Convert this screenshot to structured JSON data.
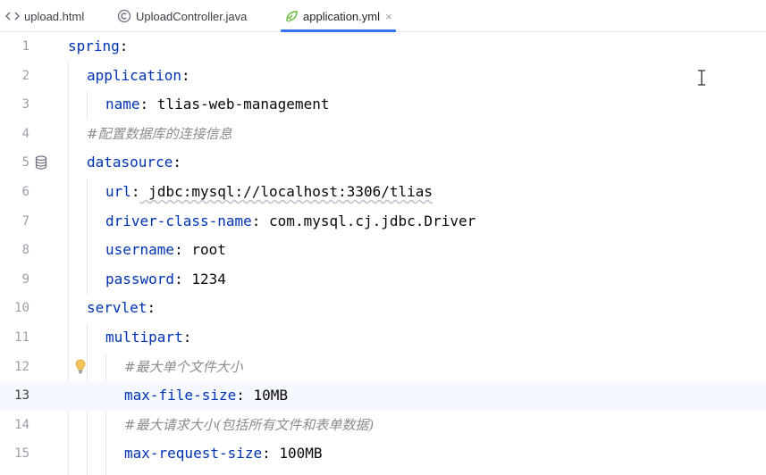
{
  "tabs": [
    {
      "name": "upload.html",
      "icon": "html-file-icon",
      "active": false
    },
    {
      "name": "UploadController.java",
      "icon": "java-class-icon",
      "active": false
    },
    {
      "name": "application.yml",
      "icon": "spring-config-icon",
      "active": true,
      "close": "×"
    }
  ],
  "editor": {
    "current_line": 13,
    "lines": [
      {
        "num": "1",
        "key": "spring",
        "colon": ":",
        "value": ""
      },
      {
        "num": "2",
        "key": "application",
        "colon": ":",
        "value": ""
      },
      {
        "num": "3",
        "key": "name",
        "colon": ":",
        "value": " tlias-web-management"
      },
      {
        "num": "4",
        "comment": "#配置数据库的连接信息"
      },
      {
        "num": "5",
        "key": "datasource",
        "colon": ":",
        "value": ""
      },
      {
        "num": "6",
        "key": "url",
        "colon": ":",
        "value": " jdbc:mysql://localhost:3306/tlias"
      },
      {
        "num": "7",
        "key": "driver-class-name",
        "colon": ":",
        "value": " com.mysql.cj.jdbc.Driver"
      },
      {
        "num": "8",
        "key": "username",
        "colon": ":",
        "value": " root"
      },
      {
        "num": "9",
        "key": "password",
        "colon": ":",
        "value": " 1234"
      },
      {
        "num": "10",
        "key": "servlet",
        "colon": ":",
        "value": ""
      },
      {
        "num": "11",
        "key": "multipart",
        "colon": ":",
        "value": ""
      },
      {
        "num": "12",
        "comment": "#最大单个文件大小"
      },
      {
        "num": "13",
        "key": "max-file-size",
        "colon": ":",
        "value": " 10MB"
      },
      {
        "num": "14",
        "comment": "#最大请求大小(包括所有文件和表单数据)"
      },
      {
        "num": "15",
        "key": "max-request-size",
        "colon": ":",
        "value": " 100MB"
      }
    ]
  },
  "colors": {
    "key": "#0033b3",
    "comment": "#8c8c8c",
    "active_tab_underline": "#3574f0",
    "current_line_bg": "#f5f8fe"
  }
}
